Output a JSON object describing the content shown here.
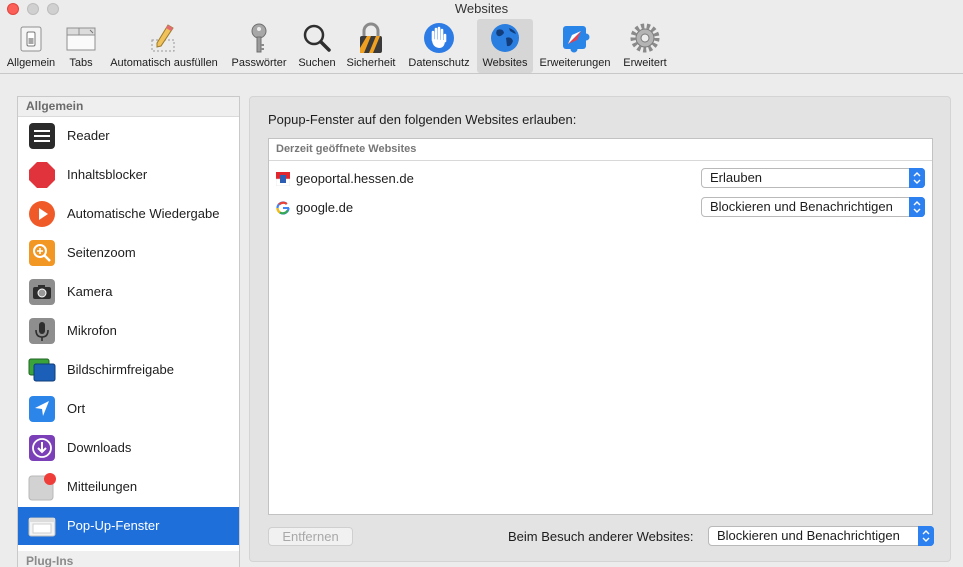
{
  "window": {
    "title": "Websites"
  },
  "toolbar": {
    "items": [
      {
        "label": "Allgemein",
        "icon": "switch-icon"
      },
      {
        "label": "Tabs",
        "icon": "tabs-icon"
      },
      {
        "label": "Automatisch ausfüllen",
        "icon": "pencil-icon"
      },
      {
        "label": "Passwörter",
        "icon": "key-icon"
      },
      {
        "label": "Suchen",
        "icon": "magnifier-icon"
      },
      {
        "label": "Sicherheit",
        "icon": "lock-icon"
      },
      {
        "label": "Datenschutz",
        "icon": "hand-icon"
      },
      {
        "label": "Websites",
        "icon": "globe-icon",
        "active": true
      },
      {
        "label": "Erweiterungen",
        "icon": "puzzle-icon"
      },
      {
        "label": "Erweitert",
        "icon": "gear-icon"
      }
    ]
  },
  "sidebar": {
    "header": "Allgemein",
    "items": [
      {
        "label": "Reader",
        "icon": "reader-icon"
      },
      {
        "label": "Inhaltsblocker",
        "icon": "stop-sign-icon"
      },
      {
        "label": "Automatische Wiedergabe",
        "icon": "play-icon"
      },
      {
        "label": "Seitenzoom",
        "icon": "zoom-icon"
      },
      {
        "label": "Kamera",
        "icon": "camera-icon"
      },
      {
        "label": "Mikrofon",
        "icon": "microphone-icon"
      },
      {
        "label": "Bildschirmfreigabe",
        "icon": "screen-share-icon"
      },
      {
        "label": "Ort",
        "icon": "location-icon"
      },
      {
        "label": "Downloads",
        "icon": "download-icon"
      },
      {
        "label": "Mitteilungen",
        "icon": "notification-icon"
      },
      {
        "label": "Pop-Up-Fenster",
        "icon": "popup-window-icon",
        "selected": true
      }
    ],
    "footer": "Plug-Ins"
  },
  "main": {
    "title": "Popup-Fenster auf den folgenden Websites erlauben:",
    "table_header": "Derzeit geöffnete Websites",
    "rows": [
      {
        "site": "geoportal.hessen.de",
        "setting": "Erlauben",
        "favicon": "hessen-flag-icon"
      },
      {
        "site": "google.de",
        "setting": "Blockieren und Benachrichtigen",
        "favicon": "google-g-icon"
      }
    ],
    "remove_button": "Entfernen",
    "other_websites_label": "Beim Besuch anderer Websites:",
    "other_websites_value": "Blockieren und Benachrichtigen"
  },
  "colors": {
    "selection": "#1e6fd9",
    "popup_arrow": "#2d80ef",
    "close_button": "#fc5f57"
  }
}
